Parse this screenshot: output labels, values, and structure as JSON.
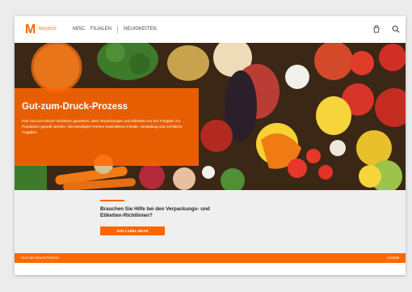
{
  "brand": {
    "logo_letter": "M",
    "logo_text": "MIGROS",
    "accent": "#ff6600"
  },
  "nav": {
    "items": [
      {
        "label": "MISC"
      },
      {
        "label": "FILIALEN"
      },
      {
        "label": "NEUIGKEITEN"
      }
    ]
  },
  "header_icons": [
    "shopping-bag-icon",
    "search-icon"
  ],
  "hero": {
    "title": "Gut-zum-Druck-Prozess",
    "body": "Das Gut-zum-Druck-Verfahren garantiert, dass Verpackungen und Etiketten vor der Freigabe zur Produktion geprüft werden. Alle beteiligten Partner kontrollieren Inhalte, Gestaltung und rechtliche Angaben."
  },
  "cta": {
    "text": "Brauchen Sie Hilfe bei den Verpackungs- und Etiketten-Richtlinien?",
    "button_label": "ZUR LABEL-HILFE"
  },
  "footer": {
    "left": "Gut-zum-Druck-Prozess",
    "right": "Kontakt"
  }
}
